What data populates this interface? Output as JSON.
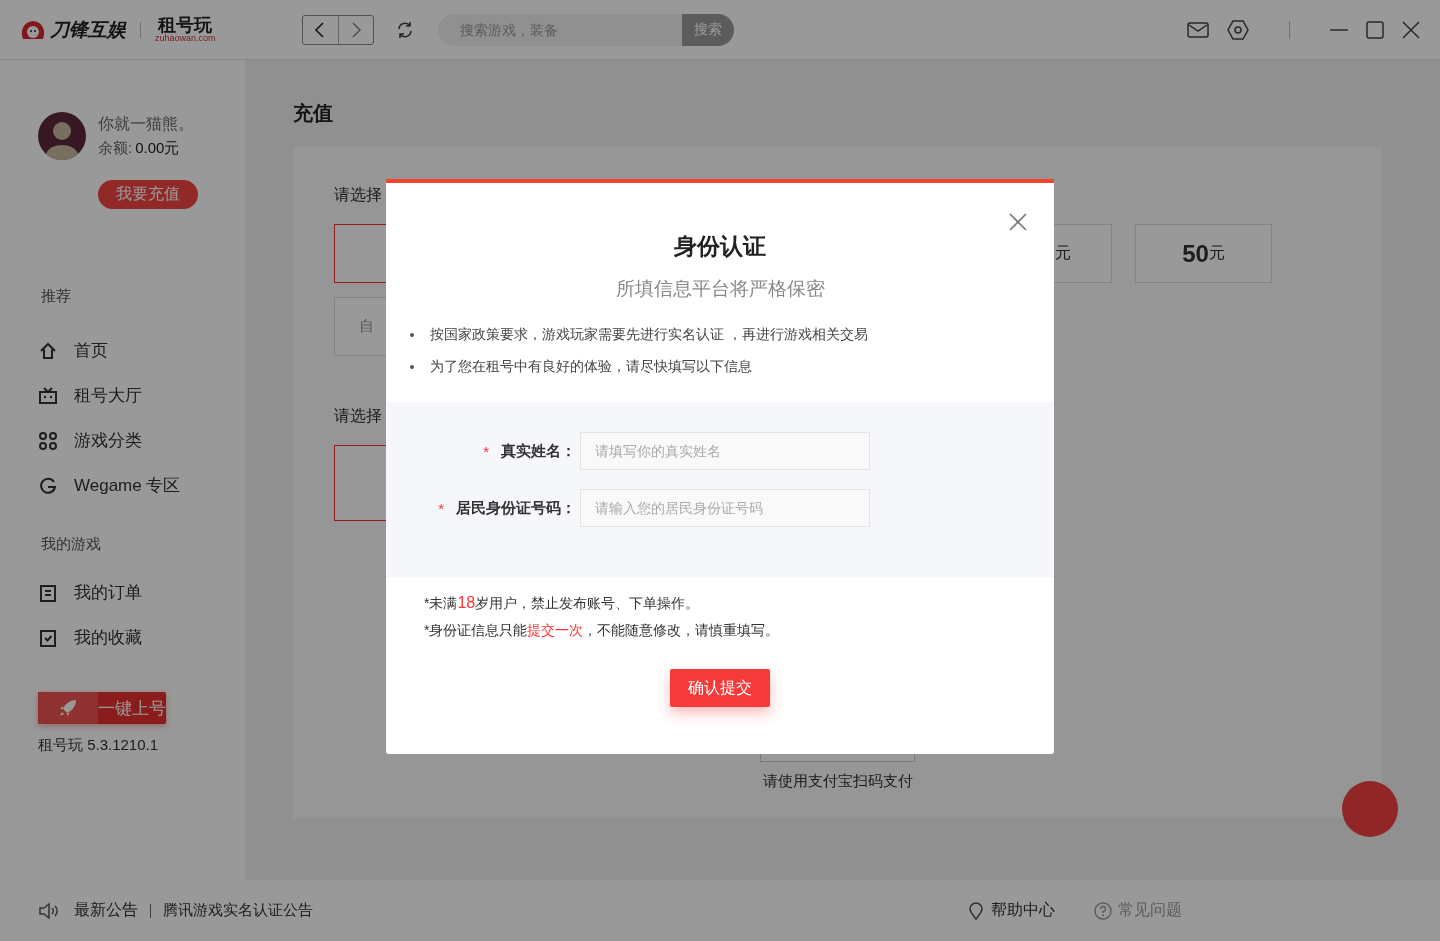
{
  "header": {
    "brand": "刀锋互娱",
    "product_logo": "租号玩",
    "product_logo_sub": "zuhaowan.com",
    "search": {
      "placeholder": "搜索游戏，装备",
      "button": "搜索"
    }
  },
  "sidebar": {
    "user": {
      "name": "你就一猫熊。",
      "balance_label": "余额:",
      "balance_value": "0.00",
      "balance_unit": "元"
    },
    "recharge_button": "我要充值",
    "sections": [
      {
        "title": "推荐",
        "items": [
          {
            "label": "首页"
          },
          {
            "label": "租号大厅"
          },
          {
            "label": "游戏分类"
          },
          {
            "label": "Wegame 专区"
          }
        ]
      },
      {
        "title": "我的游戏",
        "items": [
          {
            "label": "我的订单"
          },
          {
            "label": "我的收藏"
          }
        ]
      }
    ],
    "launch_button": "一键上号",
    "version": "租号玩 5.3.1210.1"
  },
  "main": {
    "title": "充值",
    "amount_label": "请选择",
    "amount_options": [
      {
        "selected": true
      },
      {
        "selected": false,
        "unit": "元"
      },
      {
        "selected": false,
        "value": "50",
        "unit": "元"
      }
    ],
    "custom_amount": "自",
    "payment_label": "请选择",
    "payment_options": [
      {
        "selected": true
      }
    ],
    "qr_caption": "请使用支付宝扫码支付"
  },
  "status_bar": {
    "notice_label": "最新公告",
    "notice_text": "腾讯游戏实名认证公告",
    "links": [
      {
        "label": "帮助中心"
      },
      {
        "label": "常见问题"
      }
    ]
  },
  "dialog": {
    "title": "身份认证",
    "subtitle": "所填信息平台将严格保密",
    "notices": [
      "按国家政策要求，游戏玩家需要先进行实名认证 ，再进行游戏相关交易",
      "为了您在租号中有良好的体验，请尽快填写以下信息"
    ],
    "fields": [
      {
        "required_mark": "*",
        "label": "真实姓名：",
        "placeholder": "请填写你的真实姓名"
      },
      {
        "required_mark": "*",
        "label": "居民身份证号码：",
        "placeholder": "请输入您的居民身份证号码"
      }
    ],
    "warnings": [
      "*未满**18**岁用户，禁止发布账号、下单操作。",
      "*身份证信息只能**提交一次**，不能随意修改，请慎重填写。"
    ],
    "submit_button": "确认提交"
  }
}
